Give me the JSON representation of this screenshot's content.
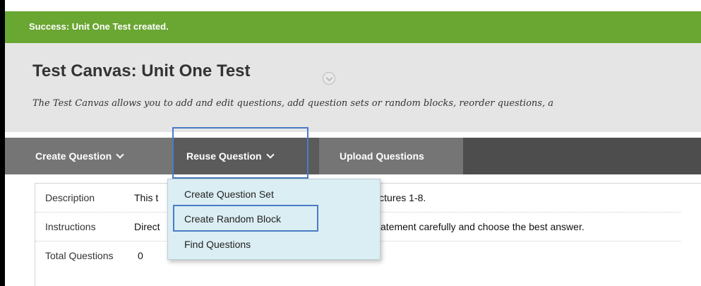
{
  "notification": {
    "text": "Success: Unit One Test created."
  },
  "header": {
    "title": "Test Canvas: Unit One Test",
    "description": "The Test Canvas allows you to add and edit questions, add question sets or random blocks, reorder questions, a"
  },
  "actionbar": {
    "items": [
      {
        "label": "Create Question"
      },
      {
        "label": "Reuse Question"
      },
      {
        "label": "Upload Questions"
      }
    ]
  },
  "details": {
    "rows": [
      {
        "label": "Description",
        "value_start": "This t",
        "value_end": "and lectures 1-8."
      },
      {
        "label": "Instructions",
        "value_start": "Direct",
        "value_end": "atement carefully and choose the best answer."
      },
      {
        "label": "Total Questions",
        "value": "0"
      }
    ]
  },
  "reuse_menu": {
    "items": [
      {
        "label": "Create Question Set"
      },
      {
        "label": "Create Random Block"
      },
      {
        "label": "Find Questions"
      }
    ]
  },
  "colors": {
    "success": "#6aa632",
    "header_bg": "#e5e5e5",
    "actionbar_bg": "#757575",
    "menu_bg": "#dbeef3",
    "highlight": "#4a7bc8"
  }
}
